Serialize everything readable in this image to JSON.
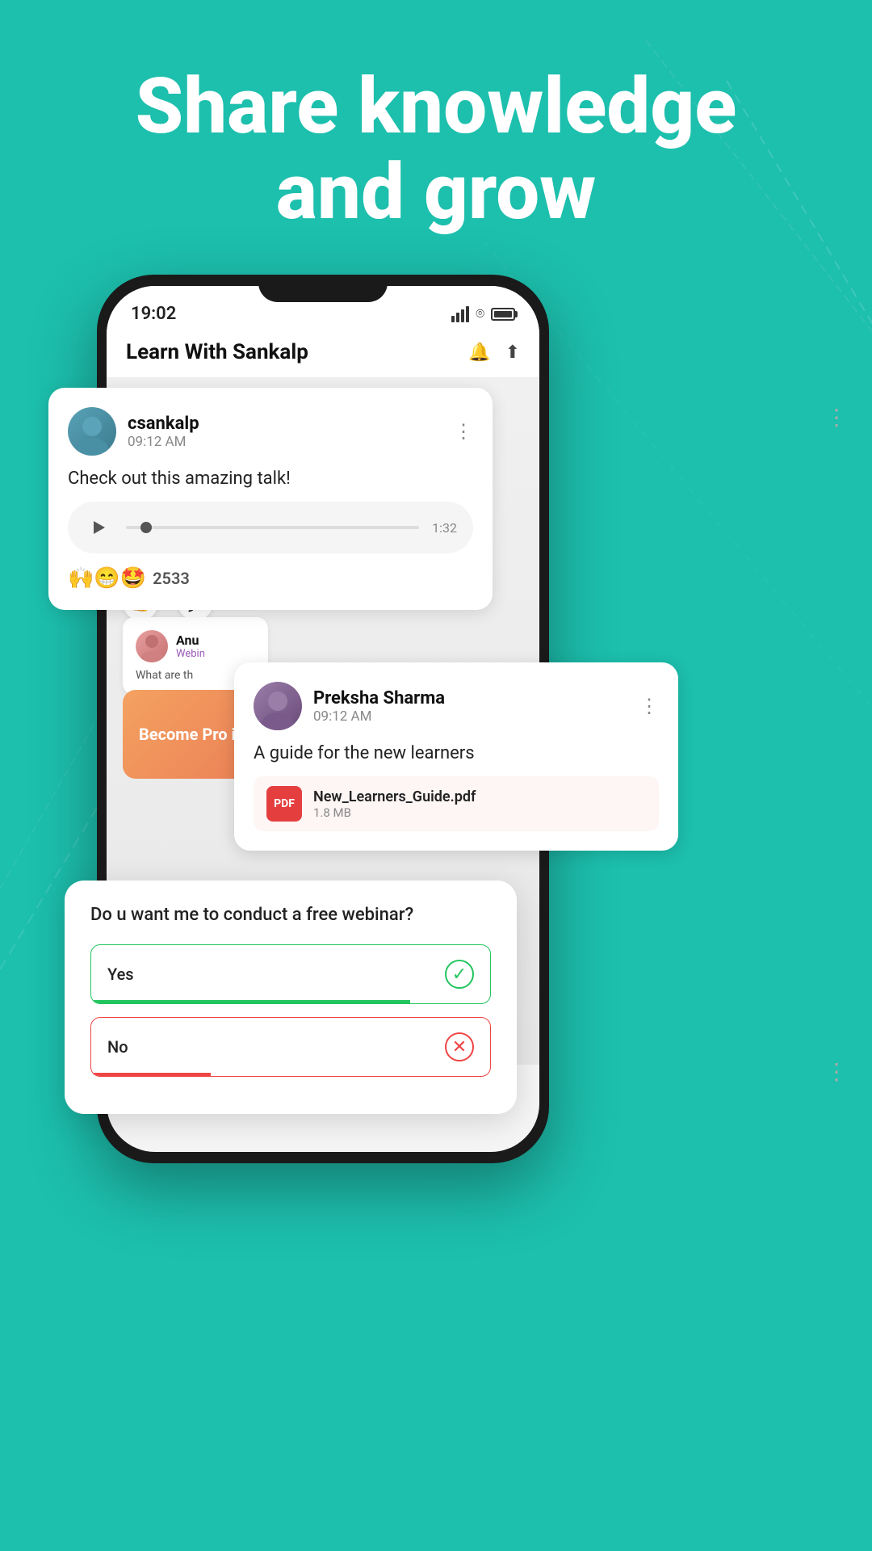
{
  "hero": {
    "title_line1": "Share knowledge",
    "title_line2": "and grow"
  },
  "status_bar": {
    "time": "19:02"
  },
  "phone_header": {
    "title": "Learn With Sankalp",
    "bell_icon": "bell-icon",
    "share_icon": "share-icon"
  },
  "post1": {
    "username": "csankalp",
    "time": "09:12 AM",
    "text": "Check out this amazing talk!",
    "audio_duration": "1:32",
    "reactions": "🙌😁🤩",
    "reaction_count": "2533",
    "more_icon": "more-dots-icon"
  },
  "post2": {
    "username": "Preksha Sharma",
    "time": "09:12 AM",
    "text": "A guide for the new learners",
    "file_name": "New_Learners_Guide.pdf",
    "file_size": "1.8 MB",
    "more_icon": "more-dots-icon"
  },
  "community": {
    "name": "Anu",
    "tag": "Webin",
    "text": "What are th"
  },
  "become_pro": {
    "text": "Become Pro in"
  },
  "poll": {
    "question": "Do u want me to conduct a free webinar?",
    "option_yes": "Yes",
    "option_no": "No",
    "yes_icon": "✓",
    "no_icon": "✕"
  },
  "colors": {
    "bg": "#1DBFAD",
    "yes_color": "#22c55e",
    "no_color": "#ef4444",
    "pdf_color": "#e53e3e"
  }
}
